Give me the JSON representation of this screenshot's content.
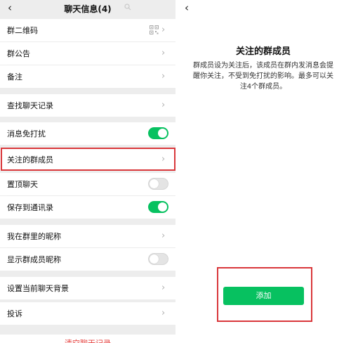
{
  "left_screen": {
    "header": {
      "back_glyph": "‹",
      "title": "聊天信息(4)",
      "search_icon": "search-icon"
    },
    "rows": [
      {
        "label": "群二维码",
        "control": "qr-chevron"
      },
      {
        "label": "群公告",
        "control": "chevron"
      },
      {
        "label": "备注",
        "control": "chevron"
      },
      {
        "label": "查找聊天记录",
        "control": "chevron"
      },
      {
        "label": "消息免打扰",
        "control": "toggle",
        "toggle_on": true
      },
      {
        "label": "关注的群成员",
        "control": "chevron",
        "highlighted": true
      },
      {
        "label": "置顶聊天",
        "control": "toggle",
        "toggle_on": false
      },
      {
        "label": "保存到通讯录",
        "control": "toggle",
        "toggle_on": true
      },
      {
        "label": "我在群里的昵称",
        "control": "chevron"
      },
      {
        "label": "显示群成员昵称",
        "control": "toggle",
        "toggle_on": false
      },
      {
        "label": "设置当前聊天背景",
        "control": "chevron"
      },
      {
        "label": "投诉",
        "control": "chevron"
      }
    ],
    "chevron_glyph": "›",
    "clear_history": "清空聊天记录"
  },
  "right_screen": {
    "back_glyph": "‹",
    "title": "关注的群成员",
    "description": "群成员设为关注后，该成员在群内发消息会提醒你关注，不受到免打扰的影响。最多可以关注4个群成员。",
    "add_button": "添加"
  },
  "colors": {
    "accent_green": "#07c160",
    "highlight_red": "#d9373b",
    "danger_red": "#e64340",
    "background_gray": "#ededed"
  }
}
